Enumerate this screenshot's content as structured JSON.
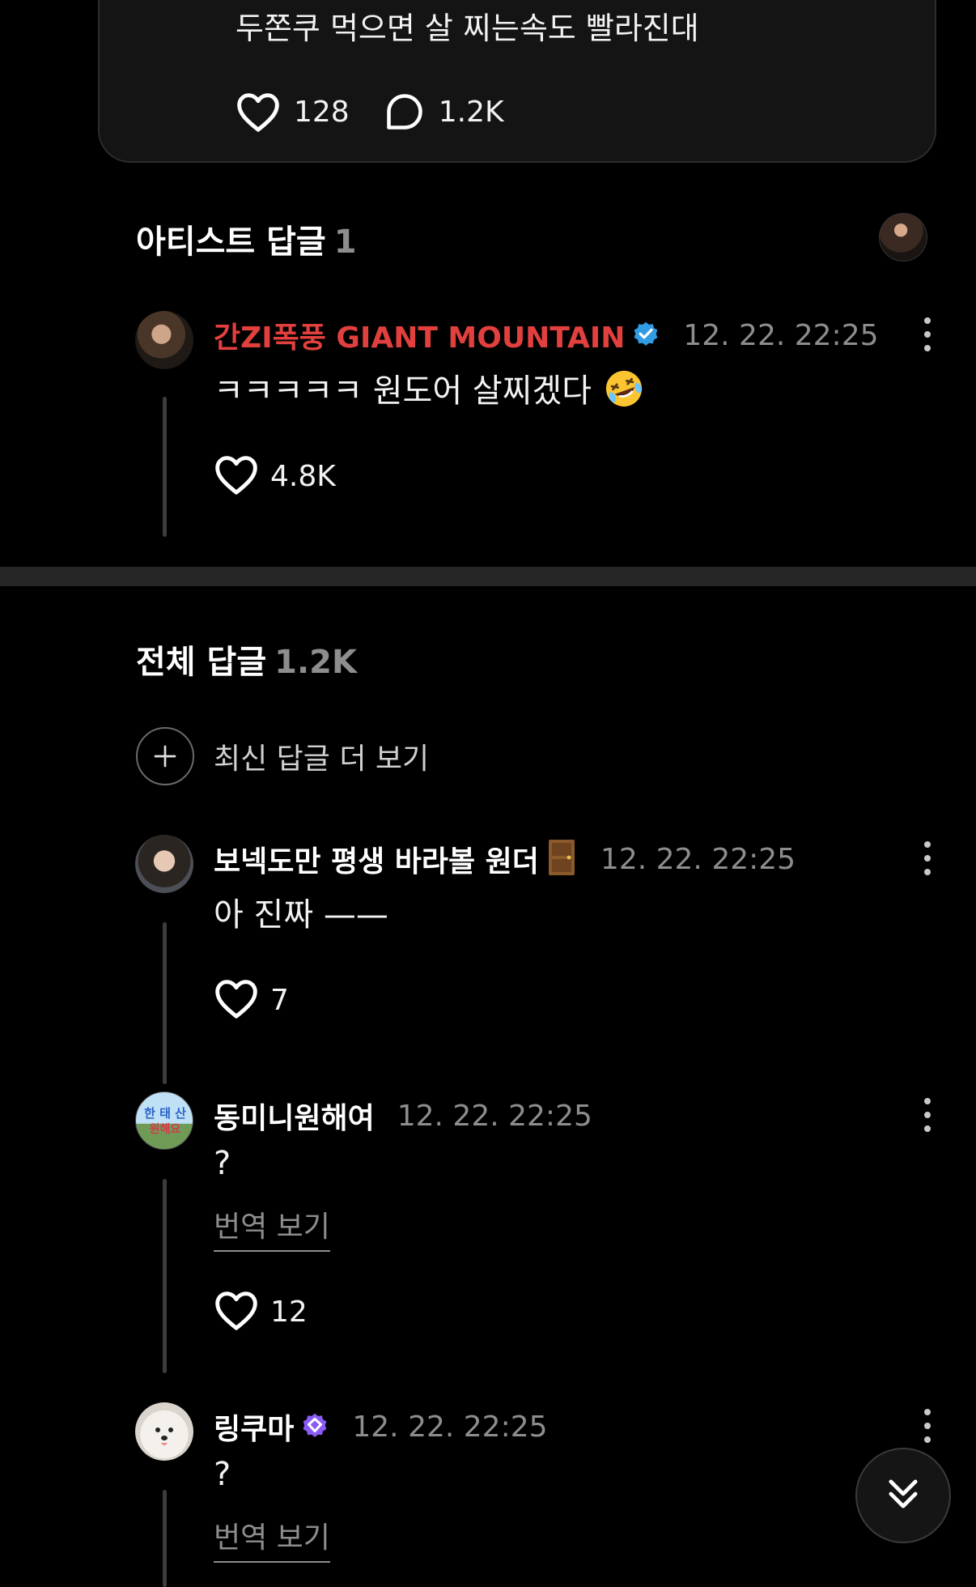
{
  "post": {
    "text": "두쫀쿠 먹으면 살 찌는속도 빨라진대",
    "likes": "128",
    "comments": "1.2K"
  },
  "artist_section": {
    "title": "아티스트 답글",
    "count": "1"
  },
  "artist_reply": {
    "name": "간ZI폭풍 GIANT MOUNTAIN",
    "time": "12. 22. 22:25",
    "text": "ㅋㅋㅋㅋㅋ 원도어 살찌겠다",
    "likes": "4.8K"
  },
  "all_section": {
    "title": "전체 답글",
    "count": "1.2K"
  },
  "more_replies_label": "최신 답글 더 보기",
  "replies": [
    {
      "name": "보넥도만 평생 바라볼 원더",
      "time": "12. 22. 22:25",
      "text": "아 진짜 ——",
      "likes": "7"
    },
    {
      "name": "동미니원해여",
      "time": "12. 22. 22:25",
      "text": "?",
      "translate": "번역 보기",
      "likes": "12",
      "avatar_text": [
        "한 태 산",
        "원해요"
      ]
    },
    {
      "name": "링쿠마",
      "time": "12. 22. 22:25",
      "text": "?",
      "translate": "번역 보기"
    }
  ],
  "colors": {
    "artist_name": "#e2403e",
    "verified_blue": "#2f9ce3",
    "verified_purple": "#8a5cf5",
    "muted": "#8d8d8d"
  },
  "icons": [
    "heart-icon",
    "comment-icon",
    "more-icon",
    "plus-icon",
    "verified-badge-icon",
    "scroll-down-icon",
    "door-emoji",
    "laughing-emoji"
  ]
}
